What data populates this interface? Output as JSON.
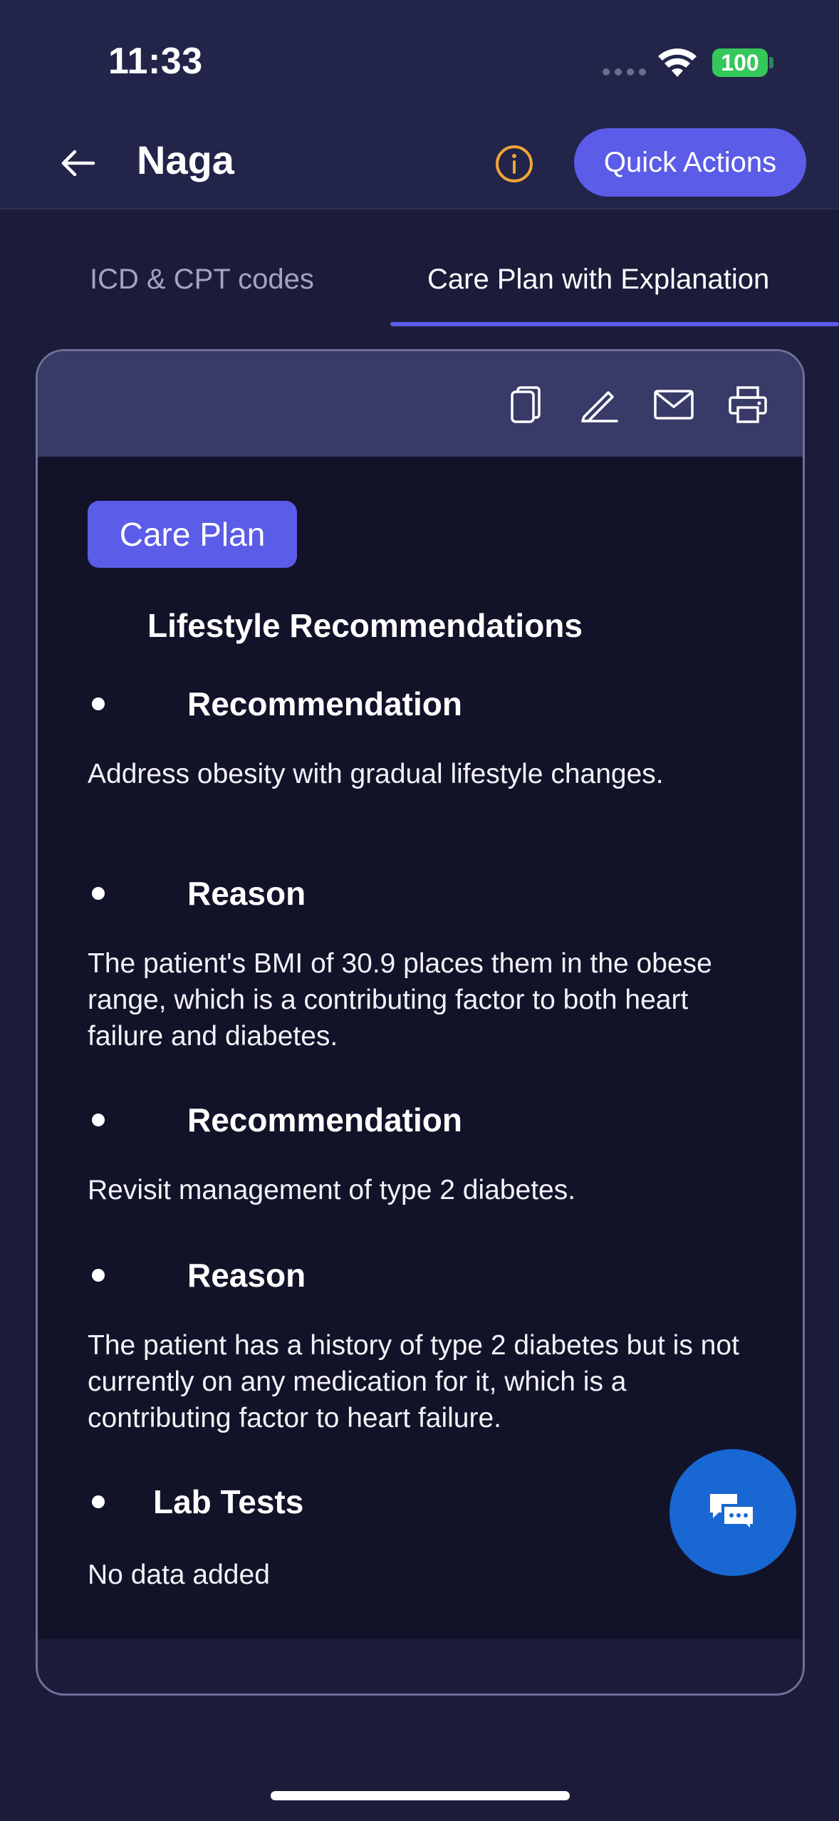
{
  "status_bar": {
    "time": "11:33",
    "battery": "100"
  },
  "header": {
    "title": "Naga",
    "quick_actions_label": "Quick Actions"
  },
  "tabs": [
    {
      "label": "ICD & CPT codes",
      "active": false
    },
    {
      "label": "Care Plan with Explanation",
      "active": true
    }
  ],
  "toolbar": {
    "icons": [
      "copy-icon",
      "edit-icon",
      "mail-icon",
      "print-icon"
    ]
  },
  "care_plan": {
    "badge": "Care Plan",
    "section_title": "Lifestyle Recommendations",
    "items": [
      {
        "heading": "Recommendation",
        "text": "Address obesity with gradual lifestyle changes."
      },
      {
        "heading": "Reason",
        "text": "The patient's BMI of 30.9 places them in the obese range, which is a contributing factor to both heart failure and diabetes."
      },
      {
        "heading": "Recommendation",
        "text": "Revisit management of type 2 diabetes."
      },
      {
        "heading": "Reason",
        "text": "The patient has a history of type 2 diabetes but is not currently on any medication for it, which is a contributing factor to heart failure."
      },
      {
        "heading": "Lab Tests",
        "text": "No data added"
      }
    ]
  },
  "colors": {
    "accent": "#5b5ce8",
    "background": "#1b1c3a",
    "card_body": "#121329",
    "fab": "#1867d2",
    "info": "#f0a43a"
  }
}
